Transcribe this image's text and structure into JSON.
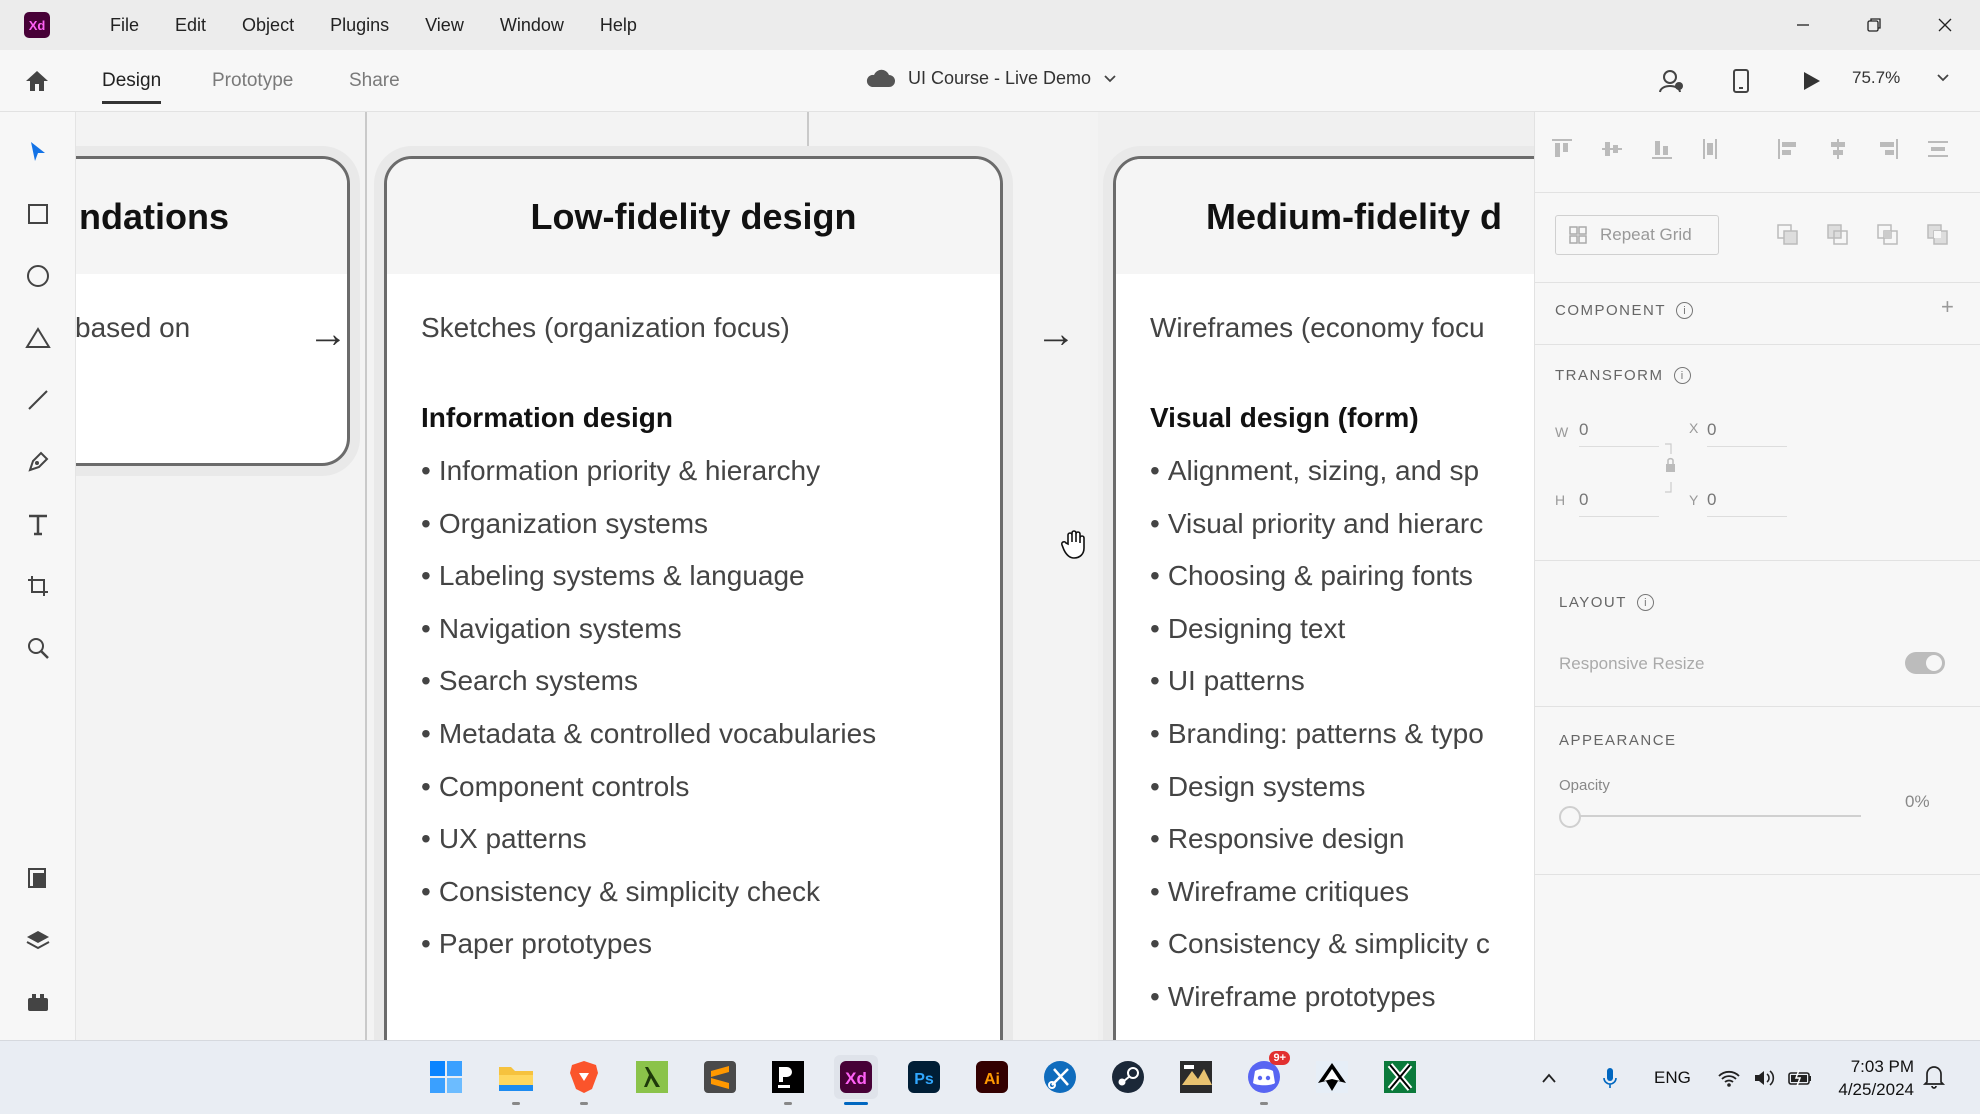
{
  "app": {
    "logo_text": "Xd",
    "menu": [
      "File",
      "Edit",
      "Object",
      "Plugins",
      "View",
      "Window",
      "Help"
    ]
  },
  "toolbar": {
    "tabs": [
      "Design",
      "Prototype",
      "Share"
    ],
    "active_tab": "Design",
    "document_title": "UI Course - Live Demo",
    "zoom": "75.7%"
  },
  "canvas": {
    "cards": [
      {
        "title": "ndations",
        "subtitle": "based on",
        "section": "",
        "items": []
      },
      {
        "title": "Low-fidelity design",
        "subtitle": "Sketches (organization focus)",
        "section": "Information design",
        "items": [
          "Information priority & hierarchy",
          "Organization systems",
          "Labeling systems & language",
          "Navigation systems",
          "Search systems",
          "Metadata & controlled vocabularies",
          "Component controls",
          "UX patterns",
          "Consistency & simplicity check",
          "Paper prototypes"
        ]
      },
      {
        "title": "Medium-fidelity d",
        "subtitle": "Wireframes (economy focu",
        "section": "Visual design (form)",
        "items": [
          "Alignment, sizing, and sp",
          "Visual priority and hierarc",
          "Choosing & pairing fonts",
          "Designing text",
          "UI patterns",
          "Branding: patterns & typo",
          "Design systems",
          "Responsive design",
          "Wireframe critiques",
          "Consistency & simplicity c",
          "Wireframe prototypes"
        ]
      }
    ],
    "arrow": "→"
  },
  "properties": {
    "repeat_grid": "Repeat Grid",
    "component_label": "COMPONENT",
    "transform_label": "TRANSFORM",
    "w_label": "W",
    "w_value": "0",
    "h_label": "H",
    "h_value": "0",
    "x_label": "X",
    "x_value": "0",
    "y_label": "Y",
    "y_value": "0",
    "layout_label": "LAYOUT",
    "responsive_resize": "Responsive Resize",
    "appearance_label": "APPEARANCE",
    "opacity_label": "Opacity",
    "opacity_value": "0%"
  },
  "taskbar": {
    "apps": [
      "windows-start",
      "file-explorer",
      "brave",
      "lambda",
      "sublime-text",
      "pycharm",
      "adobe-xd",
      "photoshop",
      "illustrator",
      "snipping-tool",
      "steam",
      "game",
      "discord",
      "inkscape",
      "excel"
    ],
    "discord_badge": "9+",
    "language": "ENG",
    "time": "7:03 PM",
    "date": "4/25/2024"
  },
  "colors": {
    "accent": "#1473e6",
    "xd_bg": "#470137",
    "xd_fg": "#ff61f6"
  }
}
